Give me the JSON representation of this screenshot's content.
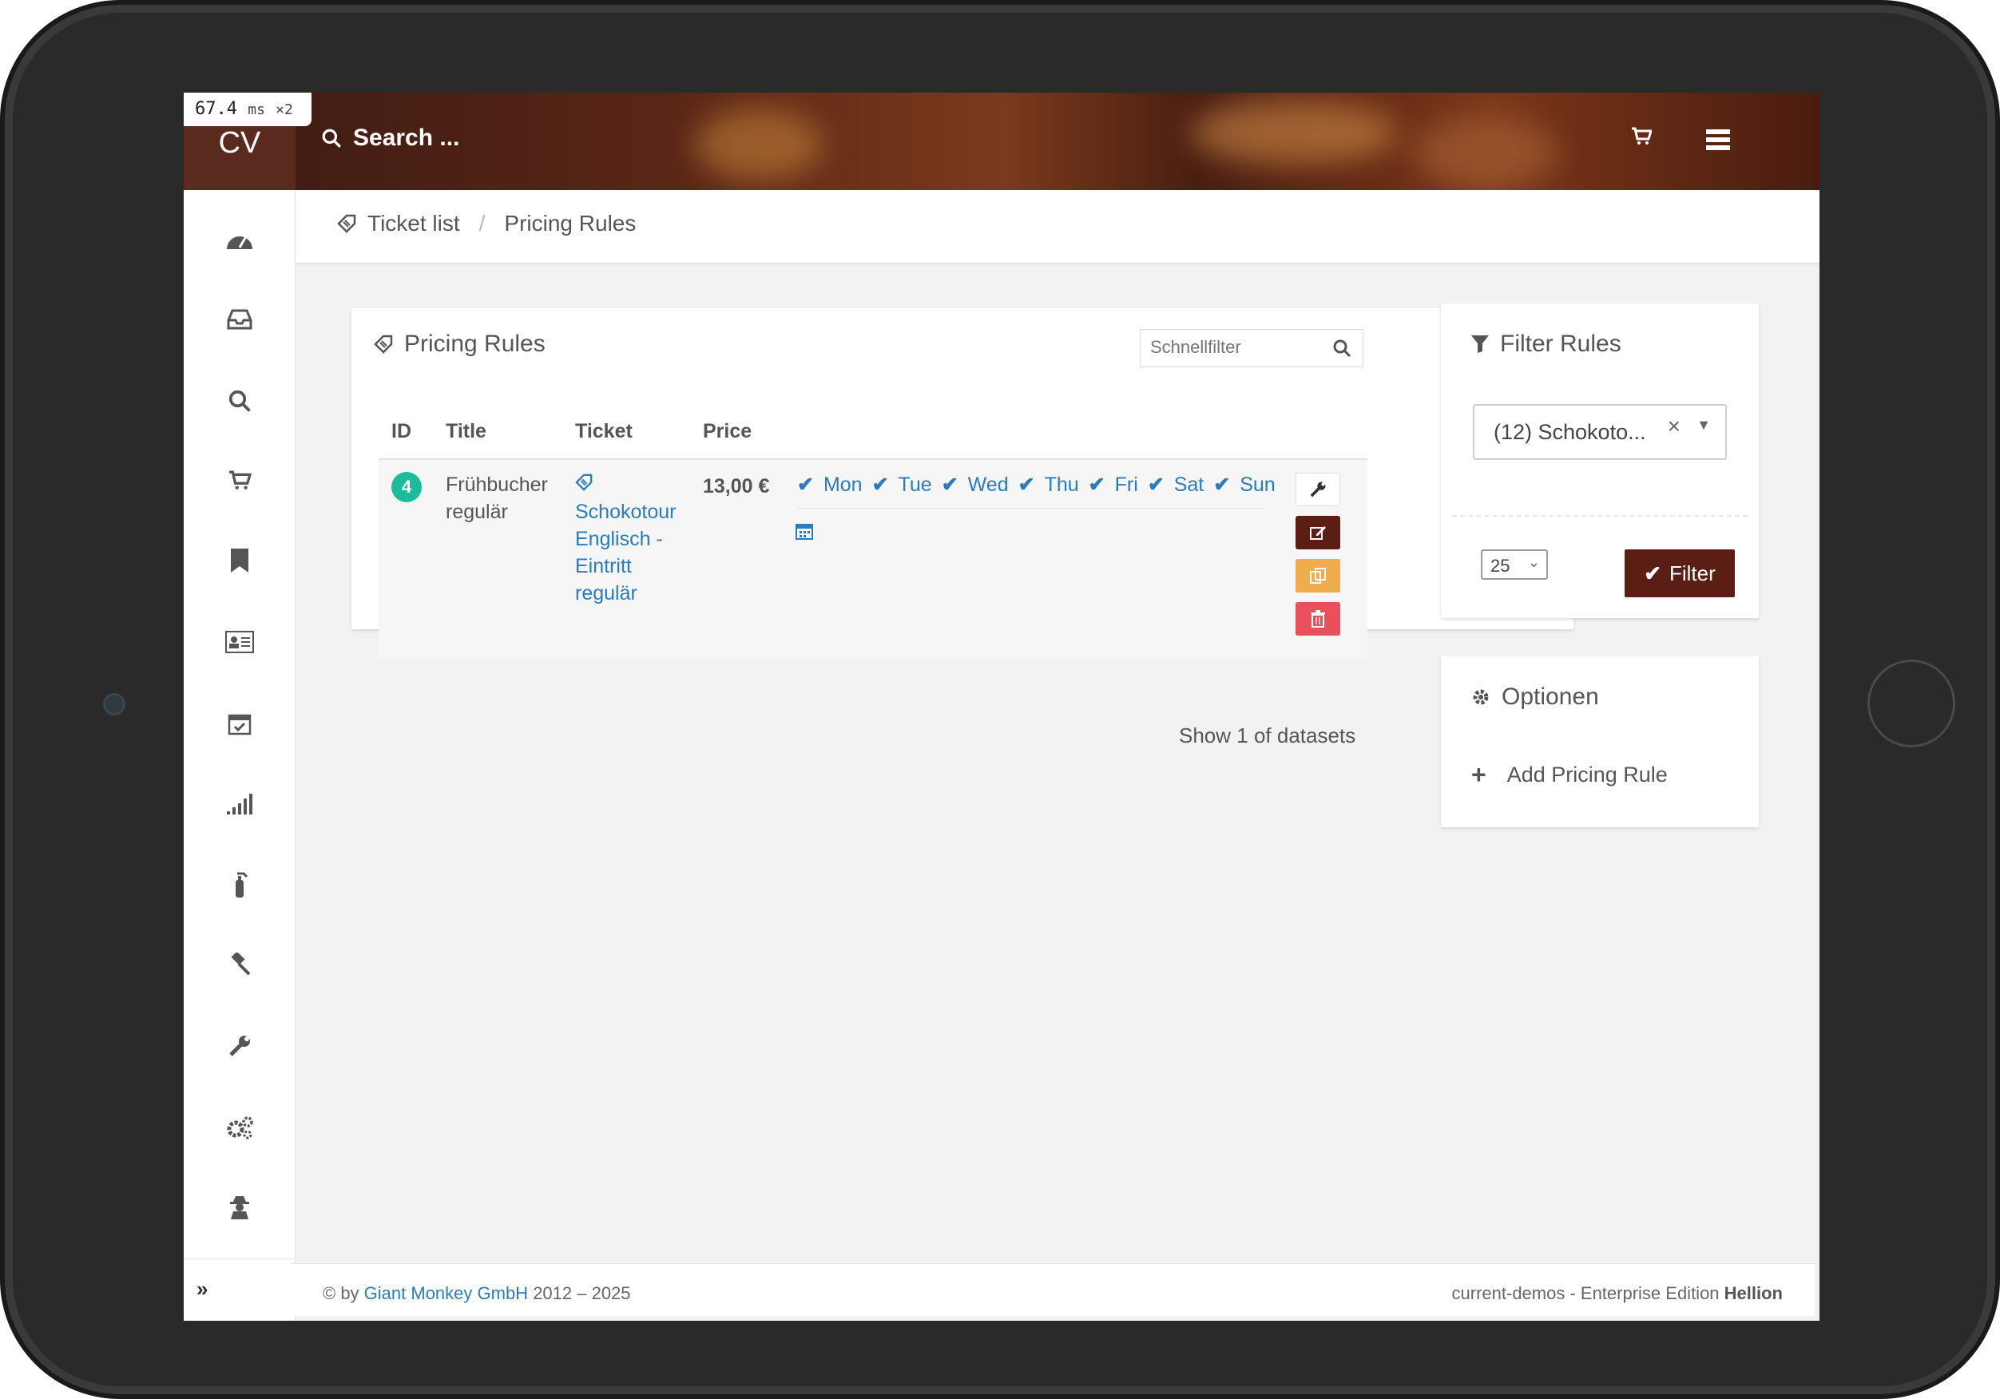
{
  "perf": {
    "value": "67.4",
    "unit": "ms",
    "mult": "×2"
  },
  "header": {
    "logo": "CV",
    "search_label": "Search ...",
    "cart_icon": "shopping-cart-icon",
    "menu_icon": "list-icon"
  },
  "sidebar": {
    "items": [
      {
        "icon": "dashboard-icon"
      },
      {
        "icon": "inbox-icon"
      },
      {
        "icon": "search-icon"
      },
      {
        "icon": "cart-icon"
      },
      {
        "icon": "bookmark-icon"
      },
      {
        "icon": "id-card-icon"
      },
      {
        "icon": "calendar-check-icon"
      },
      {
        "icon": "signal-icon"
      },
      {
        "icon": "fire-extinguisher-icon"
      },
      {
        "icon": "gavel-icon"
      },
      {
        "icon": "wrench-icon"
      },
      {
        "icon": "cogs-icon"
      },
      {
        "icon": "user-secret-icon"
      }
    ],
    "expand_icon": "double-chevron-right-icon"
  },
  "breadcrumb": {
    "items": [
      {
        "label": "Ticket list"
      },
      {
        "label": "Pricing Rules"
      }
    ]
  },
  "rules_panel": {
    "title": "Pricing Rules",
    "quickfilter_placeholder": "Schnellfilter",
    "columns": {
      "id": "ID",
      "title": "Title",
      "ticket": "Ticket",
      "price": "Price"
    },
    "rows": [
      {
        "id": "4",
        "title_line1": "Frühbucher",
        "title_line2": "regulär",
        "ticket_lines": [
          "Schokotour",
          "Englisch -",
          "Eintritt",
          "regulär"
        ],
        "price": "13,00 €",
        "days": [
          "Mon",
          "Tue",
          "Wed",
          "Thu",
          "Fri",
          "Sat",
          "Sun"
        ]
      }
    ],
    "footer_text": "Show 1 of datasets",
    "colors": {
      "edit": "#5a1e14",
      "copy": "#f0ad4e",
      "delete": "#e8505b",
      "badge": "#1abc9c",
      "link": "#2a7bbf"
    }
  },
  "filter_panel": {
    "title": "Filter Rules",
    "selected": "(12) Schokoto...",
    "per_page": "25",
    "button_label": "Filter"
  },
  "options_panel": {
    "title": "Optionen",
    "add_label": "Add Pricing Rule"
  },
  "footer": {
    "prefix": "© by ",
    "company": "Giant Monkey GmbH",
    "years": " 2012 – 2025",
    "right_prefix": "current-demos - Enterprise Edition ",
    "right_bold": "Hellion"
  }
}
